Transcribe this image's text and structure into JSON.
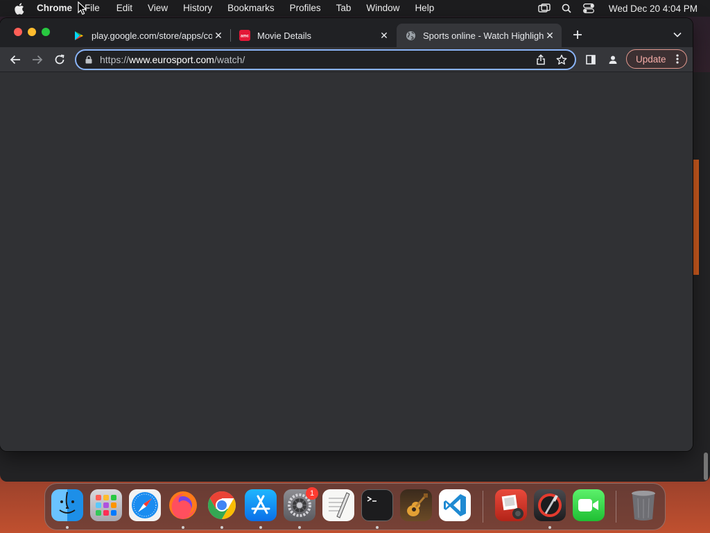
{
  "menubar": {
    "app_name": "Chrome",
    "items": [
      "File",
      "Edit",
      "View",
      "History",
      "Bookmarks",
      "Profiles",
      "Tab",
      "Window",
      "Help"
    ],
    "clock": "Wed Dec 20  4:04 PM"
  },
  "tabs": [
    {
      "title": "play.google.com/store/apps/co",
      "favicon": "google-play-icon"
    },
    {
      "title": "Movie Details",
      "favicon": "amc-icon"
    },
    {
      "title": "Sports online - Watch Highligh",
      "favicon": "globe-icon",
      "active": true
    }
  ],
  "omnibox": {
    "scheme": "https://",
    "host": "www.eurosport.com",
    "path": "/watch/"
  },
  "toolbar": {
    "update_label": "Update"
  },
  "dock": {
    "apps": [
      "Finder",
      "Launchpad",
      "Safari",
      "Firefox",
      "Chrome",
      "App Store",
      "System Settings",
      "TextEdit",
      "Terminal",
      "GarageBand",
      "Visual Studio Code",
      "Photo Booth",
      "Instruments",
      "FaceTime",
      "Trash"
    ],
    "settings_badge": "1"
  },
  "colors": {
    "accent": "#8ab4f8",
    "update": "#f6aea9",
    "content_bg": "#303134"
  }
}
